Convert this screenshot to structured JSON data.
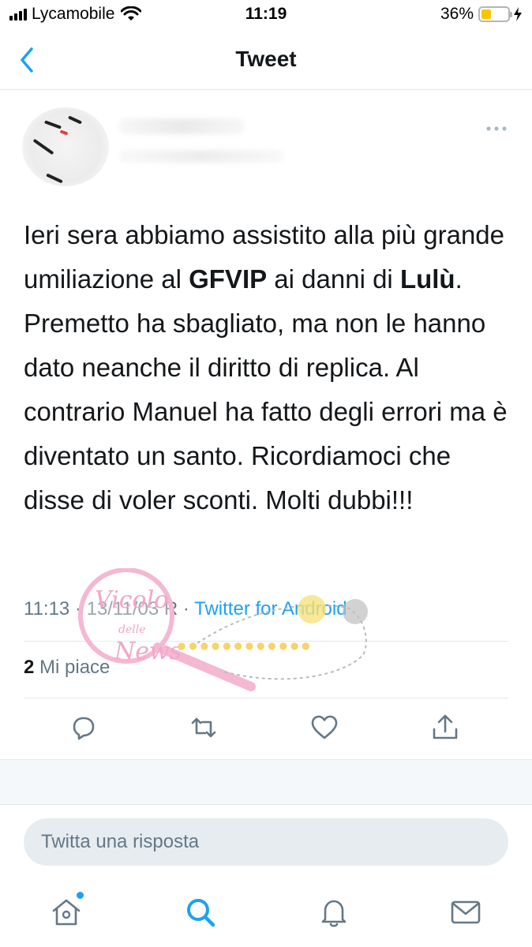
{
  "status_bar": {
    "carrier": "Lycamobile",
    "time": "11:19",
    "battery_percent": "36%",
    "battery_level": 0.36,
    "battery_color": "#f7c600"
  },
  "nav": {
    "title": "Tweet",
    "back_icon": "chevron-left-icon"
  },
  "tweet": {
    "text_parts": {
      "p1": "Ieri sera abbiamo assistito alla più grande umiliazione al ",
      "b1": "GFVIP",
      "p2": " ai danni di ",
      "b2": "Lulù",
      "p3": ". Premetto ha sbagliato, ma non le hanno dato neanche il diritto di replica. Al contrario  Manuel ha fatto degli errori ma è diventato un santo. Ricordiamoci che disse di voler sconti. Molti dubbi!!!"
    },
    "timestamp": "11:13 · 13/11/03 R · ",
    "source": "Twitter for Android",
    "likes_count": "2",
    "likes_label": " Mi piace"
  },
  "actions": {
    "reply_icon": "reply-icon",
    "retweet_icon": "retweet-icon",
    "like_icon": "heart-icon",
    "share_icon": "share-icon"
  },
  "reply": {
    "placeholder": "Twitta una risposta"
  },
  "tabbar": {
    "items": [
      "home-icon",
      "search-icon",
      "notifications-icon",
      "messages-icon"
    ]
  },
  "watermark": {
    "script_text": "Vicolo delle News"
  },
  "colors": {
    "twitter_blue": "#1da1f2",
    "secondary_text": "#657786",
    "divider": "#e1e8ed"
  }
}
